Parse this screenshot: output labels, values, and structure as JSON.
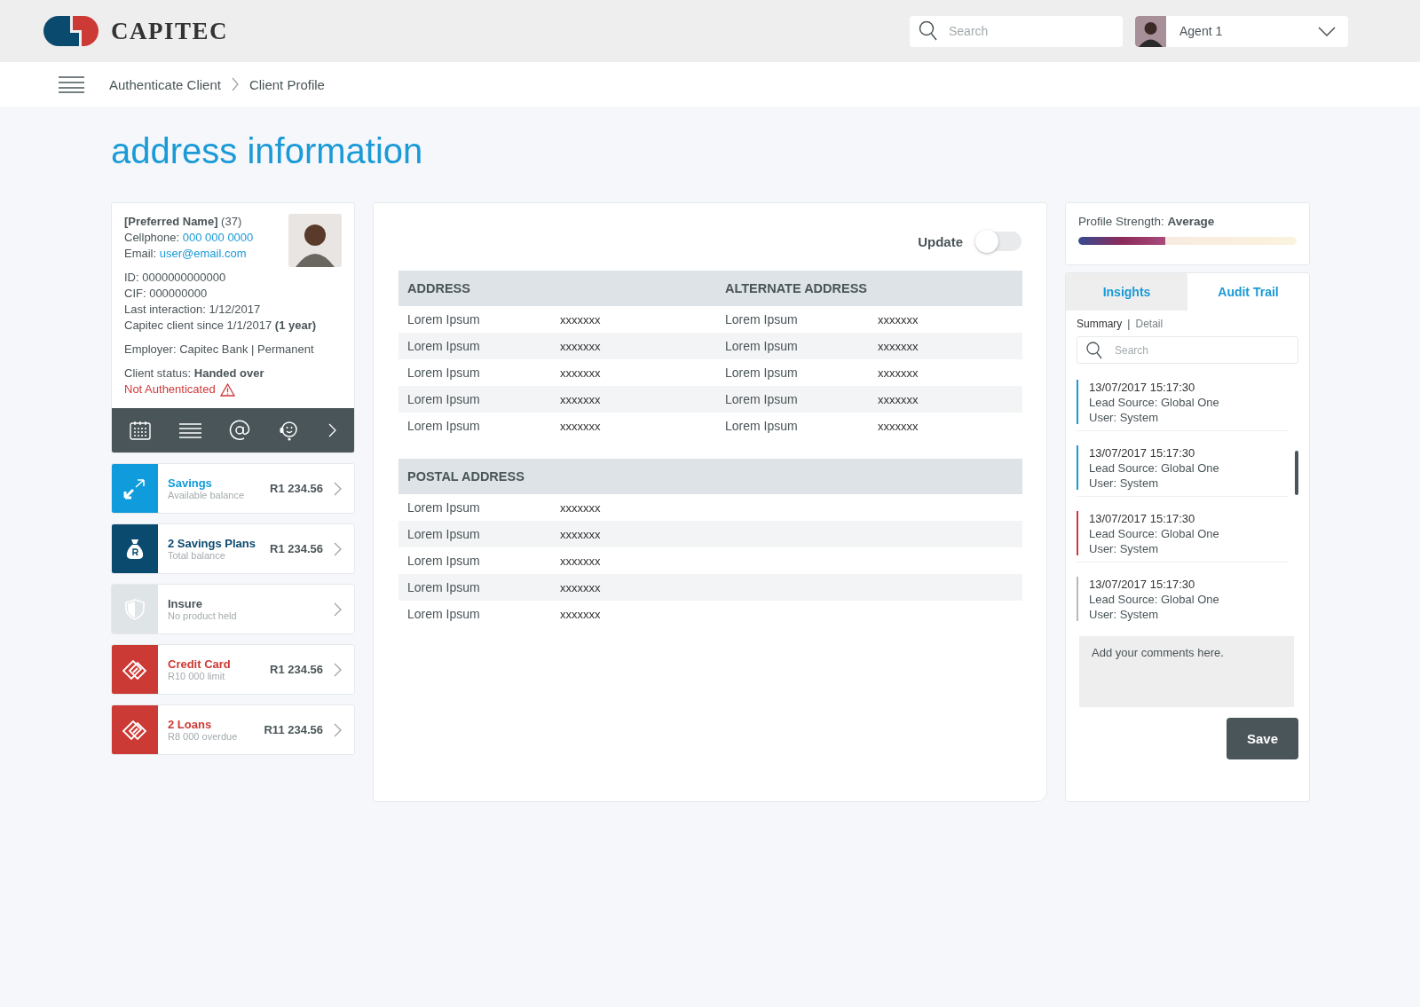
{
  "header": {
    "brand": "CAPITEC",
    "search": {
      "placeholder": "Search"
    },
    "agent": {
      "name": "Agent 1"
    }
  },
  "breadcrumb": [
    "Authenticate Client",
    "Client Profile"
  ],
  "page_title": "address information",
  "client": {
    "groups": [
      [
        {
          "text": "**[Preferred Name]** (37)"
        },
        {
          "text": "Cellphone: ",
          "link": "000 000 0000"
        },
        {
          "text": "Email: ",
          "link": "user@email.com"
        }
      ],
      [
        {
          "text": "ID: 0000000000000"
        },
        {
          "text": "CIF: 000000000"
        },
        {
          "text": "Last interaction: 1/12/2017"
        },
        {
          "text": "Capitec client since 1/1/2017 **(1 year)**"
        }
      ],
      [
        {
          "text": "Employer: Capitec Bank | Permanent"
        }
      ],
      [
        {
          "text": "Client status: **Handed over**"
        }
      ]
    ],
    "auth_status": "Not Authenticated",
    "authenticated": false
  },
  "products": [
    {
      "kind": "transfer",
      "name": "Savings",
      "sub": "Available balance",
      "amount": "R1 234.56",
      "color": "#0f9bdc",
      "disabled": false
    },
    {
      "kind": "moneybag",
      "name": "2 Savings Plans",
      "sub": "Total balance",
      "amount": "R1 234.56",
      "color": "#0b4a6f",
      "disabled": false
    },
    {
      "kind": "shield",
      "name": "Insure",
      "sub": "No product held",
      "color": "#dfe4e6",
      "disabled": true
    },
    {
      "kind": "card",
      "name": "Credit Card",
      "sub": "R10 000 limit",
      "amount": "R1 234.56",
      "color": "#cc3a35",
      "disabled": false
    },
    {
      "kind": "card",
      "name": "2 Loans",
      "sub": "R8 000 overdue",
      "amount": "R11 234.56",
      "color": "#cc3a35",
      "disabled": false
    }
  ],
  "update": {
    "label": "Update",
    "on": false
  },
  "address_table": {
    "columns": [
      "ADDRESS",
      "",
      "ALTERNATE ADDRESS"
    ],
    "rows": [
      [
        "Lorem Ipsum",
        "xxxxxxx",
        "Lorem Ipsum",
        "xxxxxxx"
      ],
      [
        "Lorem Ipsum",
        "xxxxxxx",
        "Lorem Ipsum",
        "xxxxxxx"
      ],
      [
        "Lorem Ipsum",
        "xxxxxxx",
        "Lorem Ipsum",
        "xxxxxxx"
      ],
      [
        "Lorem Ipsum",
        "xxxxxxx",
        "Lorem Ipsum",
        "xxxxxxx"
      ],
      [
        "Lorem Ipsum",
        "xxxxxxx",
        "Lorem Ipsum",
        "xxxxxxx"
      ]
    ]
  },
  "postal_table": {
    "columns": [
      "POSTAL ADDRESS"
    ],
    "rows": [
      [
        "Lorem Ipsum",
        "xxxxxxx"
      ],
      [
        "Lorem Ipsum",
        "xxxxxxx"
      ],
      [
        "Lorem Ipsum",
        "xxxxxxx"
      ],
      [
        "Lorem Ipsum",
        "xxxxxxx"
      ],
      [
        "Lorem Ipsum",
        "xxxxxxx"
      ]
    ]
  },
  "profile_strength": {
    "label": "Profile Strength: ",
    "value": "Average",
    "level": 0.4
  },
  "tabs": [
    {
      "label": "Insights",
      "selected": false
    },
    {
      "label": "Audit Trail",
      "selected": true
    }
  ],
  "views": [
    {
      "label": "Summary",
      "selected": true
    },
    {
      "label": "Detail",
      "selected": false
    }
  ],
  "views_separator": "|",
  "audit_search": {
    "placeholder": "Search"
  },
  "audit_entries": [
    {
      "time": "13/07/2017  15:17:30",
      "source": "Lead Source: Global One",
      "user": "User: System",
      "color": "#1a9ad6"
    },
    {
      "time": "13/07/2017  15:17:30",
      "source": "Lead Source: Global One",
      "user": "User: System",
      "color": "#1a9ad6"
    },
    {
      "time": "13/07/2017  15:17:30",
      "source": "Lead Source: Global One",
      "user": "User: System",
      "color": "#d0393a"
    },
    {
      "time": "13/07/2017  15:17:30",
      "source": "Lead Source: Global One",
      "user": "User: System",
      "color": "#b4babd"
    }
  ],
  "comment": {
    "placeholder": "Add your comments here."
  },
  "save_button": "Save"
}
